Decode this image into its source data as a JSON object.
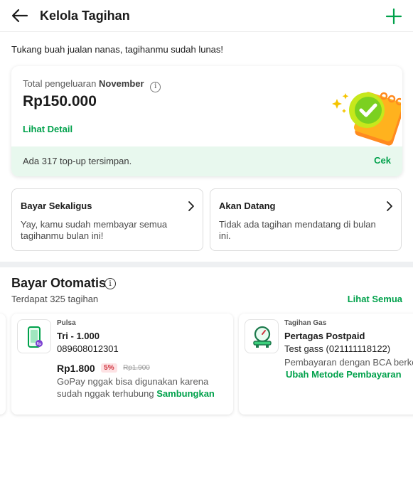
{
  "header": {
    "title": "Kelola Tagihan"
  },
  "notice": "Tukang buah jualan nanas, tagihanmu sudah lunas!",
  "summary": {
    "label_prefix": "Total pengeluaran",
    "month": "November",
    "amount": "Rp150.000",
    "detail_link": "Lihat Detail",
    "topup_text": "Ada 317 top-up tersimpan.",
    "cek_label": "Cek"
  },
  "quick_cards": [
    {
      "title": "Bayar Sekaligus",
      "desc": "Yay, kamu sudah membayar semua tagihanmu bulan ini!"
    },
    {
      "title": "Akan Datang",
      "desc": "Tidak ada tagihan mendatang di bulan ini."
    }
  ],
  "auto_pay": {
    "title": "Bayar Otomatis",
    "count_text": "Terdapat 325 tagihan",
    "see_all": "Lihat Semua",
    "bills": [
      {
        "category": "Pulsa",
        "name": "Tri - 1.000",
        "number": "089608012301",
        "price": "Rp1.800",
        "discount": "5%",
        "old_price": "Rp1.900",
        "note": "GoPay nggak bisa digunakan karena sudah nggak terhubung",
        "action": "Sambungkan"
      },
      {
        "category": "Tagihan Gas",
        "name": "Pertagas Postpaid",
        "number": "Test gass (021111118122)",
        "note": "Pembayaran dengan BCA berkc",
        "action": "Ubah Metode Pembayaran"
      }
    ]
  },
  "icons": {
    "back": "arrow-left-icon",
    "add": "plus-icon",
    "info": "info-icon",
    "chevron": "chevron-right-icon",
    "phone": "phone-icon",
    "gas": "gas-meter-icon"
  },
  "colors": {
    "accent": "#00a14b",
    "discount": "#d0343f",
    "topup_bg": "#e8f8ee"
  }
}
